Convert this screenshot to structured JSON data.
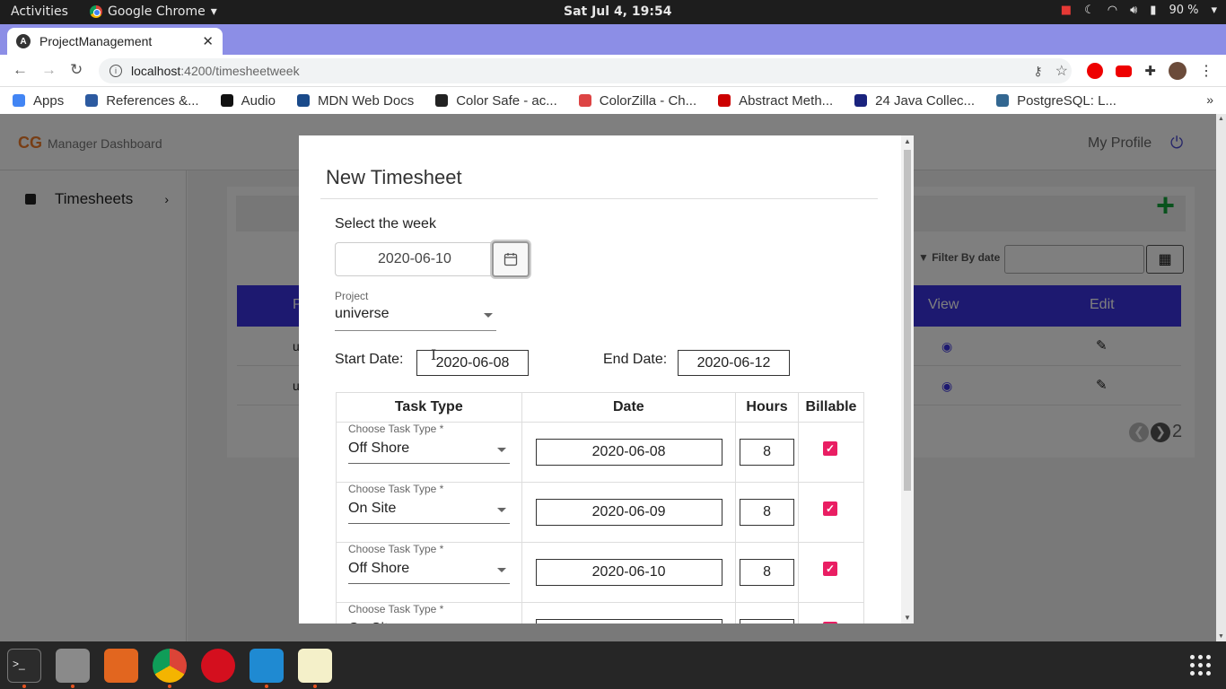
{
  "system": {
    "activities": "Activities",
    "app_menu": "Google Chrome",
    "clock": "Sat Jul  4, 19:54",
    "battery": "90 %"
  },
  "browser": {
    "tab_title": "ProjectManagement",
    "url_host": "localhost",
    "url_path": ":4200/timesheetweek",
    "bookmarks": [
      {
        "label": "Apps",
        "color": "#4285f4"
      },
      {
        "label": "References &...",
        "color": "#2c5aa0"
      },
      {
        "label": "Audio",
        "color": "#111111"
      },
      {
        "label": "MDN Web Docs",
        "color": "#1a4a8a"
      },
      {
        "label": "Color Safe - ac...",
        "color": "#222222"
      },
      {
        "label": "ColorZilla - Ch...",
        "color": "#d44"
      },
      {
        "label": "Abstract Meth...",
        "color": "#c00"
      },
      {
        "label": "24 Java Collec...",
        "color": "#1a237e"
      },
      {
        "label": "PostgreSQL: L...",
        "color": "#336791"
      }
    ]
  },
  "app": {
    "brand": "Manager Dashboard",
    "my_profile": "My Profile",
    "sidebar_item": "Timesheets",
    "filter_label": "Filter By date",
    "table_headers": {
      "first": "P",
      "view": "View",
      "edit": "Edit"
    },
    "rows": [
      {
        "initial": "u"
      },
      {
        "initial": "u"
      }
    ],
    "page_number": "2"
  },
  "modal": {
    "title": "New Timesheet",
    "week_label": "Select the week",
    "week_value": "2020-06-10",
    "project_label": "Project",
    "project_value": "universe",
    "start_label": "Start Date:",
    "start_value": "2020-06-08",
    "end_label": "End Date:",
    "end_value": "2020-06-12",
    "columns": [
      "Task Type",
      "Date",
      "Hours",
      "Billable"
    ],
    "task_label": "Choose Task Type *",
    "entries": [
      {
        "task": "Off Shore",
        "date": "2020-06-08",
        "hours": "8"
      },
      {
        "task": "On Site",
        "date": "2020-06-09",
        "hours": "8"
      },
      {
        "task": "Off Shore",
        "date": "2020-06-10",
        "hours": "8"
      },
      {
        "task": "On Site",
        "date": "",
        "hours": ""
      }
    ]
  },
  "colors": {
    "accent_blue": "#3b32e0",
    "add_green": "#13a53a",
    "checkbox_pink": "#e91e63"
  }
}
